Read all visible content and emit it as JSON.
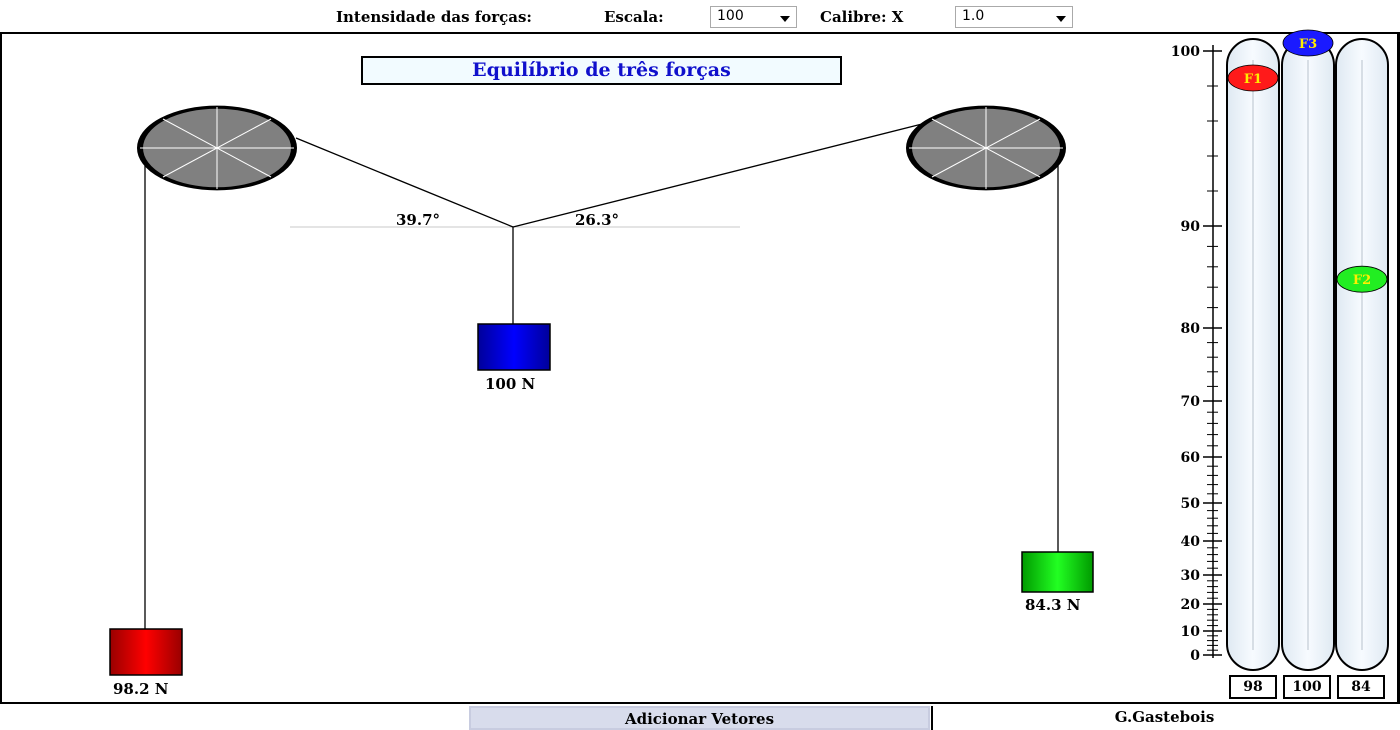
{
  "toolbar": {
    "forces_label": "Intensidade das forças:",
    "scale_label": "Escala:",
    "scale_value": "100",
    "caliber_label": "Calibre: X",
    "caliber_value": "1.0"
  },
  "scene": {
    "title": "Equilíbrio de três forças",
    "angle_left": "39.7°",
    "angle_right": "26.3°",
    "weight_center_label": "100 N",
    "weight_left_label": "98.2 N",
    "weight_right_label": "84.3 N"
  },
  "gauge": {
    "ticks": [
      "100",
      "90",
      "80",
      "70",
      "60",
      "50",
      "40",
      "30",
      "20",
      "10",
      "0"
    ],
    "f1": {
      "marker": "F1",
      "value": 98,
      "readout": "98",
      "color": "#ff1a1a",
      "text_color": "#ffee00"
    },
    "f3": {
      "marker": "F3",
      "value": 100,
      "readout": "100",
      "color": "#1a1aff",
      "text_color": "#ffee00"
    },
    "f2": {
      "marker": "F2",
      "value": 84,
      "readout": "84",
      "color": "#22ee22",
      "text_color": "#ffee00"
    }
  },
  "footer": {
    "add_vectors": "Adicionar Vetores",
    "author": "G.Gastebois"
  },
  "colors": {
    "weight_left": "#dd0000",
    "weight_center": "#0000ee",
    "weight_right": "#00dd00",
    "pulley": "#808080"
  }
}
